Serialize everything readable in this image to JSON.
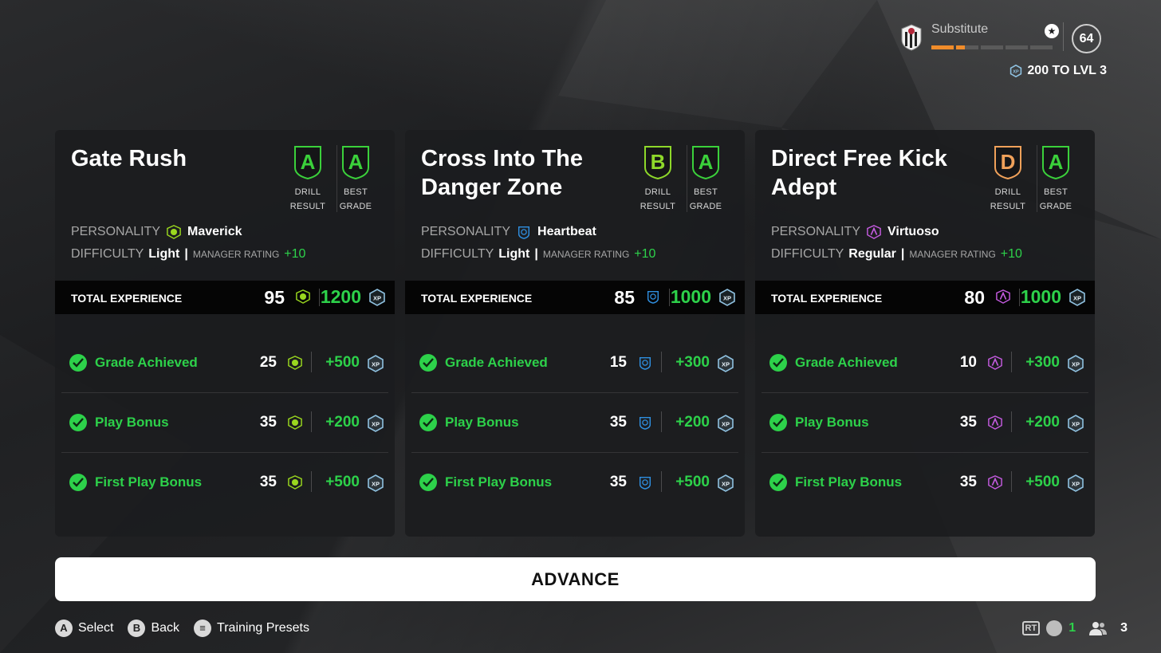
{
  "player": {
    "status": "Substitute",
    "level": "64",
    "to_level": "200 TO LVL 3",
    "progress_segments": [
      1,
      0.4,
      0,
      0,
      0
    ]
  },
  "cards": [
    {
      "title": "Gate Rush",
      "drill_result": "A",
      "drill_result_color": "#3bd13b",
      "best_grade": "A",
      "best_grade_color": "#3bd13b",
      "personality_label": "PERSONALITY",
      "personality": "Maverick",
      "personality_color": "#9ad81f",
      "difficulty_label": "DIFFICULTY",
      "difficulty": "Light",
      "manager_rating_label": "MANAGER RATING",
      "manager_rating": "+10",
      "total_label": "TOTAL EXPERIENCE",
      "total_points": "95",
      "total_xp": "1200",
      "bonuses": [
        {
          "label": "Grade Achieved",
          "points": "25",
          "xp": "+500"
        },
        {
          "label": "Play Bonus",
          "points": "35",
          "xp": "+200"
        },
        {
          "label": "First Play Bonus",
          "points": "35",
          "xp": "+500"
        }
      ]
    },
    {
      "title": "Cross Into The Danger Zone",
      "drill_result": "B",
      "drill_result_color": "#8ed82a",
      "best_grade": "A",
      "best_grade_color": "#3bd13b",
      "personality_label": "PERSONALITY",
      "personality": "Heartbeat",
      "personality_color": "#2f8fe0",
      "difficulty_label": "DIFFICULTY",
      "difficulty": "Light",
      "manager_rating_label": "MANAGER RATING",
      "manager_rating": "+10",
      "total_label": "TOTAL EXPERIENCE",
      "total_points": "85",
      "total_xp": "1000",
      "bonuses": [
        {
          "label": "Grade Achieved",
          "points": "15",
          "xp": "+300"
        },
        {
          "label": "Play Bonus",
          "points": "35",
          "xp": "+200"
        },
        {
          "label": "First Play Bonus",
          "points": "35",
          "xp": "+500"
        }
      ]
    },
    {
      "title": "Direct Free Kick Adept",
      "drill_result": "D",
      "drill_result_color": "#f0a15a",
      "best_grade": "A",
      "best_grade_color": "#3bd13b",
      "personality_label": "PERSONALITY",
      "personality": "Virtuoso",
      "personality_color": "#c55be0",
      "difficulty_label": "DIFFICULTY",
      "difficulty": "Regular",
      "manager_rating_label": "MANAGER RATING",
      "manager_rating": "+10",
      "total_label": "TOTAL EXPERIENCE",
      "total_points": "80",
      "total_xp": "1000",
      "bonuses": [
        {
          "label": "Grade Achieved",
          "points": "10",
          "xp": "+300"
        },
        {
          "label": "Play Bonus",
          "points": "35",
          "xp": "+200"
        },
        {
          "label": "First Play Bonus",
          "points": "35",
          "xp": "+500"
        }
      ]
    }
  ],
  "labels": {
    "drill_result": "DRILL RESULT",
    "best_grade": "BEST GRADE",
    "xp": "XP"
  },
  "advance_label": "ADVANCE",
  "footer": {
    "hints": [
      {
        "button": "A",
        "label": "Select"
      },
      {
        "button": "B",
        "label": "Back"
      },
      {
        "button": "≡",
        "label": "Training Presets"
      }
    ],
    "rt_label": "RT",
    "voice_count": "1",
    "party_count": "3"
  },
  "colors": {
    "accent_green": "#2dd14a",
    "progress_orange": "#f08c2a",
    "xp_icon": "#8fc1e0"
  }
}
